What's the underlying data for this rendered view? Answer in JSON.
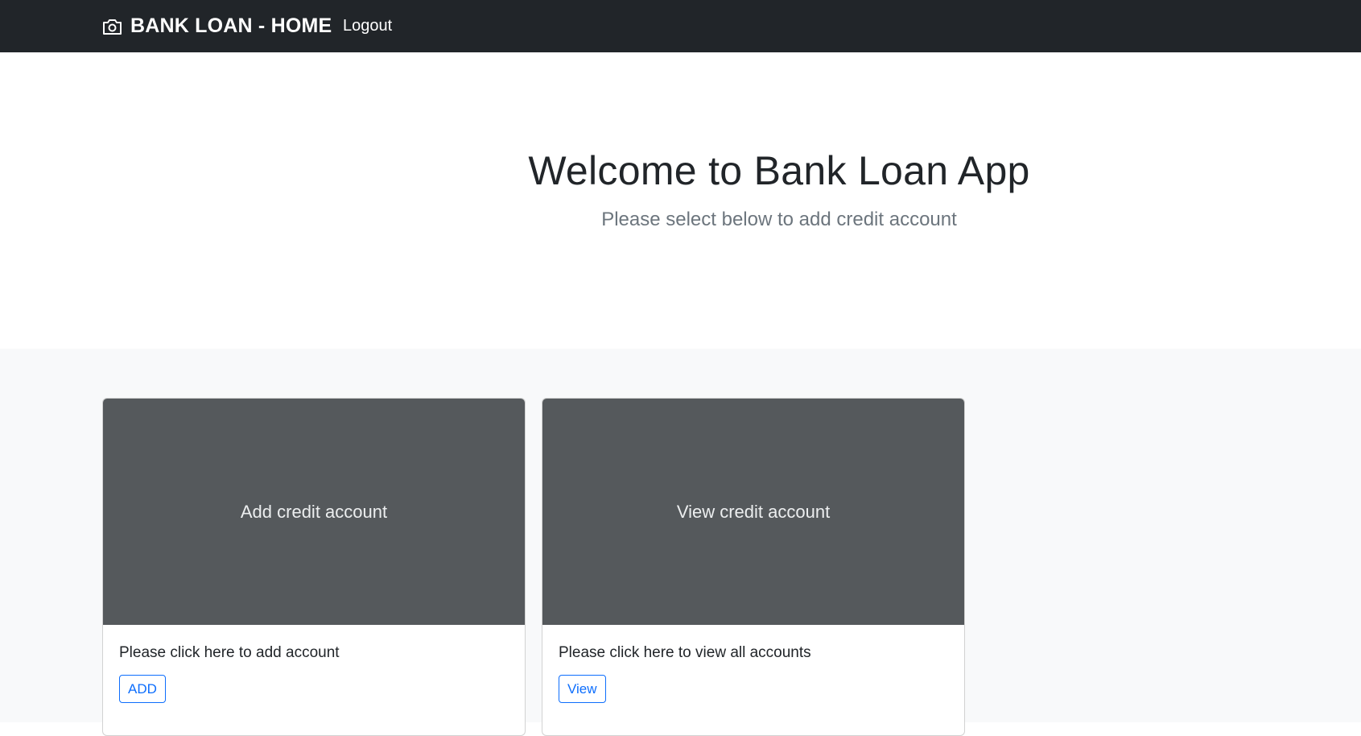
{
  "navbar": {
    "brand_icon": "camera-icon",
    "brand_label": "BANK LOAN - HOME",
    "logout_label": "Logout"
  },
  "hero": {
    "title": "Welcome to Bank Loan App",
    "subtitle": "Please select below to add credit account"
  },
  "cards": [
    {
      "image_label": "Add credit account",
      "text": "Please click here to add account",
      "button_label": "ADD"
    },
    {
      "image_label": "View credit account",
      "text": "Please click here to view all accounts",
      "button_label": "View"
    }
  ],
  "colors": {
    "navbar_bg": "#212529",
    "card_image_bg": "#55595c",
    "album_bg": "#f8f9fa",
    "button_accent": "#0d6efd"
  }
}
